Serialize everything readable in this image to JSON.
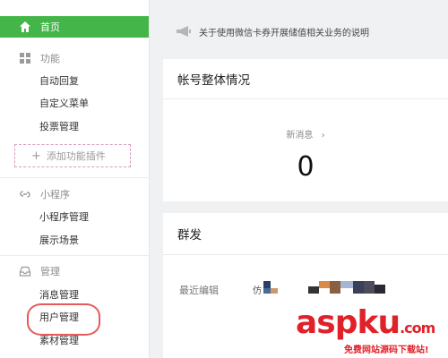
{
  "sidebar": {
    "home_label": "首页",
    "sections": [
      {
        "title": "功能",
        "icon": "grid-icon",
        "items": [
          "自动回复",
          "自定义菜单",
          "投票管理"
        ],
        "add_plugin": "添加功能插件"
      },
      {
        "title": "小程序",
        "icon": "link-icon",
        "items": [
          "小程序管理",
          "展示场景"
        ]
      },
      {
        "title": "管理",
        "icon": "inbox-icon",
        "items": [
          "消息管理",
          "用户管理",
          "素材管理"
        ]
      }
    ]
  },
  "notice": {
    "text": "关于使用微信卡券开展储值相关业务的说明",
    "icon": "megaphone-icon"
  },
  "account_card": {
    "title": "帐号整体情况",
    "new_messages_label": "新消息",
    "new_messages_value": "0"
  },
  "broadcast_card": {
    "title": "群发",
    "last_edit_label": "最近编辑",
    "last_edit_prefix": "仿"
  },
  "watermark": {
    "main_a": "asp",
    "main_b": "ku",
    "main_c": ".com",
    "sub": "免费网站源码下载站!"
  },
  "colors": {
    "accent": "#44b549",
    "highlight": "#e55a5a",
    "watermark": "#e0212a"
  }
}
